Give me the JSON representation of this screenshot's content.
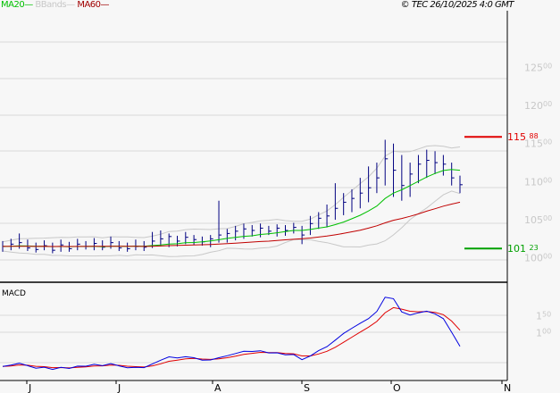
{
  "legend": {
    "ma20": "MA20",
    "bbands": "BBands",
    "ma60": "MA60"
  },
  "copyright": "© TEC 26/10/2025 4:0 GMT",
  "colors": {
    "ma20": "#00c000",
    "bbands": "#c8c8c8",
    "ma60": "#c00000",
    "bars": "#000080",
    "macd": "#0000e0",
    "signal": "#e00000",
    "resistance": "#e00000",
    "support": "#00a000"
  },
  "chart_data": [
    {
      "type": "ohlc",
      "title": "Price",
      "y_ticks": [
        {
          "int": "125",
          "dec": "00",
          "v": 125
        },
        {
          "int": "120",
          "dec": "00",
          "v": 120
        },
        {
          "int": "115",
          "dec": "00",
          "v": 115
        },
        {
          "int": "110",
          "dec": "00",
          "v": 110
        },
        {
          "int": "105",
          "dec": "00",
          "v": 105
        },
        {
          "int": "100",
          "dec": "00",
          "v": 100
        }
      ],
      "ylim": [
        96.8,
        131.5
      ],
      "x_labels": [
        "J",
        "J",
        "A",
        "S",
        "O",
        "N"
      ],
      "bars_per_day": 0.5,
      "ma_periods": [
        20,
        60
      ],
      "bars": [
        [
          102.2,
          100.8,
          101.5
        ],
        [
          102.5,
          101,
          101.8
        ],
        [
          103.2,
          101.2,
          102
        ],
        [
          102.4,
          100.9,
          101.3
        ],
        [
          102,
          100.7,
          101.1
        ],
        [
          102.3,
          101,
          101.6
        ],
        [
          102,
          100.6,
          101
        ],
        [
          102.4,
          100.8,
          101.7
        ],
        [
          102.1,
          100.8,
          101.2
        ],
        [
          102.5,
          101,
          101.8
        ],
        [
          102.2,
          101.1,
          101.5
        ],
        [
          102.6,
          101,
          101.9
        ],
        [
          102.3,
          101,
          101.4
        ],
        [
          102.8,
          101.2,
          102
        ],
        [
          102.2,
          100.9,
          101.3
        ],
        [
          102,
          100.8,
          101.2
        ],
        [
          102.4,
          101,
          101.5
        ],
        [
          102.2,
          100.9,
          101.4
        ],
        [
          103.4,
          101.3,
          102.2
        ],
        [
          103.6,
          101.5,
          102.5
        ],
        [
          103.2,
          101.4,
          102.8
        ],
        [
          102.9,
          101.5,
          102.2
        ],
        [
          103.4,
          101.8,
          102.7
        ],
        [
          103,
          101.7,
          102.4
        ],
        [
          102.8,
          101.6,
          102.1
        ],
        [
          103,
          101.4,
          102.5
        ],
        [
          107.5,
          102,
          103
        ],
        [
          103.8,
          102,
          103.2
        ],
        [
          104.2,
          102.3,
          103.5
        ],
        [
          104.5,
          102.5,
          103.8
        ],
        [
          104.3,
          102.8,
          103.6
        ],
        [
          104.5,
          102.7,
          103.9
        ],
        [
          104.2,
          103,
          103.5
        ],
        [
          104.4,
          102.8,
          103.9
        ],
        [
          104.3,
          102.9,
          103.6
        ],
        [
          104.6,
          103.2,
          104
        ],
        [
          104.2,
          101.8,
          103
        ],
        [
          105.5,
          103,
          104.5
        ],
        [
          106,
          103.8,
          105.2
        ],
        [
          107,
          104,
          105.5
        ],
        [
          109.8,
          105,
          106.5
        ],
        [
          108.5,
          105.6,
          107.3
        ],
        [
          109,
          106,
          107.8
        ],
        [
          110.5,
          106.5,
          108.5
        ],
        [
          112,
          107.3,
          109.2
        ],
        [
          112.5,
          108.5,
          110.5
        ],
        [
          115.5,
          109.5,
          113
        ],
        [
          115,
          108,
          111.5
        ],
        [
          113.5,
          107.5,
          109.5
        ],
        [
          112.5,
          108,
          111
        ],
        [
          113.5,
          109.8,
          112.3
        ],
        [
          114.2,
          110.5,
          112.8
        ],
        [
          114,
          111,
          112.5
        ],
        [
          113.5,
          110.8,
          112.3
        ],
        [
          112.5,
          109.5,
          110.5
        ],
        [
          110.8,
          108.5,
          109.6
        ]
      ],
      "levels": [
        {
          "int": "115",
          "dec": "88",
          "v": 115.88,
          "kind": "resistance"
        },
        {
          "int": "101",
          "dec": "23",
          "v": 101.23,
          "kind": "support"
        }
      ]
    },
    {
      "type": "line",
      "title": "MACD",
      "y_ticks": [
        {
          "int": "1",
          "dec": "50",
          "v": 1.5
        },
        {
          "int": "1",
          "dec": "00",
          "v": 1.0
        }
      ],
      "ylim": [
        -0.15,
        2.5
      ]
    }
  ]
}
